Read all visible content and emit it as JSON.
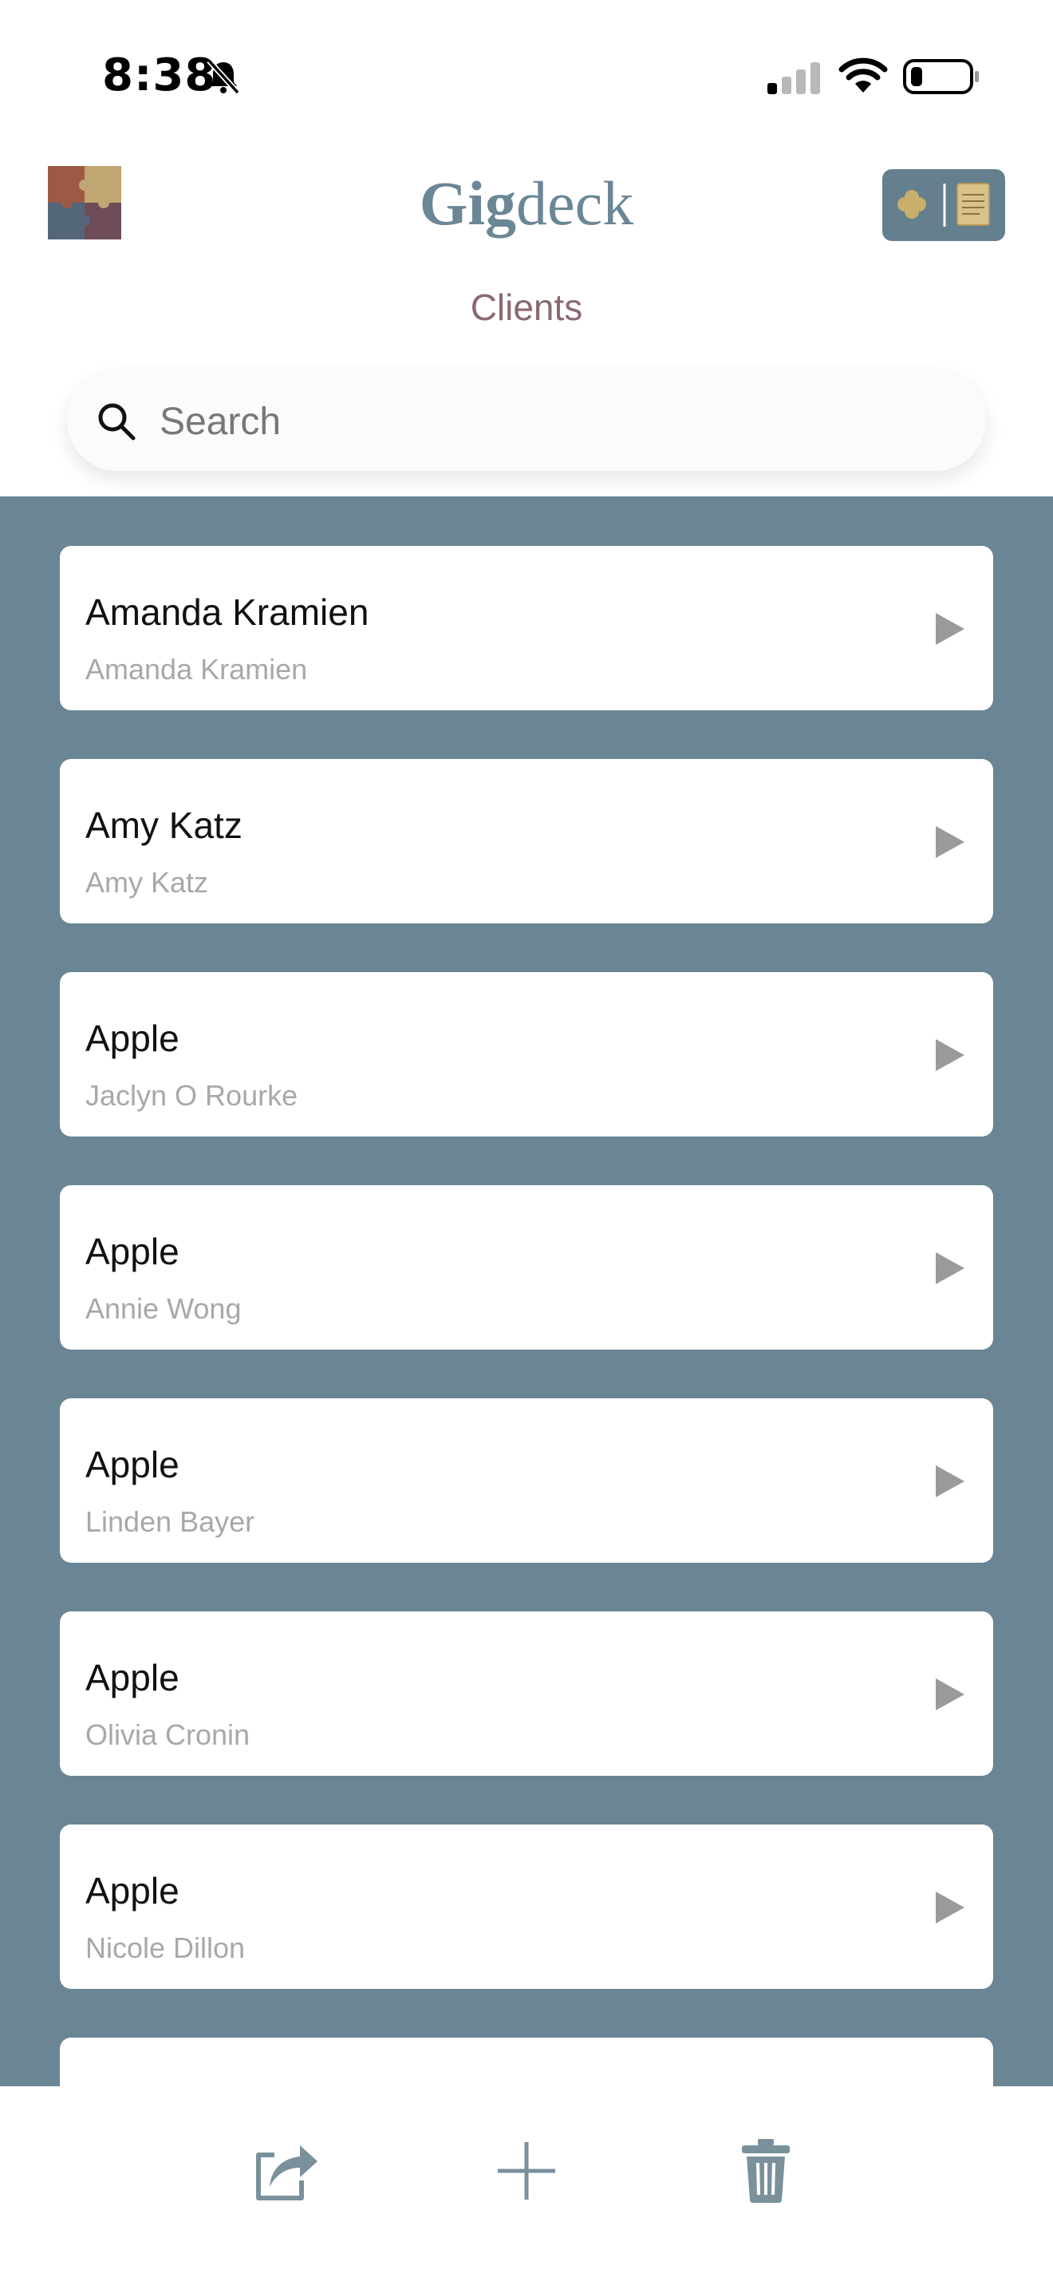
{
  "status": {
    "time": "8:38"
  },
  "header": {
    "brand_bold": "Gig",
    "brand_light": "deck",
    "title": "Clients"
  },
  "search": {
    "placeholder": "Search",
    "value": ""
  },
  "clients": [
    {
      "name": "Amanda Kramien",
      "contact": "Amanda Kramien"
    },
    {
      "name": "Amy Katz",
      "contact": "Amy Katz"
    },
    {
      "name": "Apple",
      "contact": "Jaclyn O Rourke"
    },
    {
      "name": "Apple",
      "contact": "Annie Wong"
    },
    {
      "name": "Apple",
      "contact": "Linden Bayer"
    },
    {
      "name": "Apple",
      "contact": "Olivia Cronin"
    },
    {
      "name": "Apple",
      "contact": "Nicole Dillon"
    },
    {
      "name": "",
      "contact": ""
    }
  ],
  "icons": {
    "app_logo": "puzzle-icon",
    "header_right": "clover-document-icon",
    "search": "search-icon",
    "row_chevron": "chevron-right-icon",
    "share": "share-icon",
    "add": "plus-icon",
    "delete": "trash-icon"
  },
  "colors": {
    "brand": "#6b8796",
    "title": "#8a6a6e",
    "list_background": "#6a8593",
    "subtext": "#a8a8a8",
    "toolbar_icon": "#7a919c"
  }
}
